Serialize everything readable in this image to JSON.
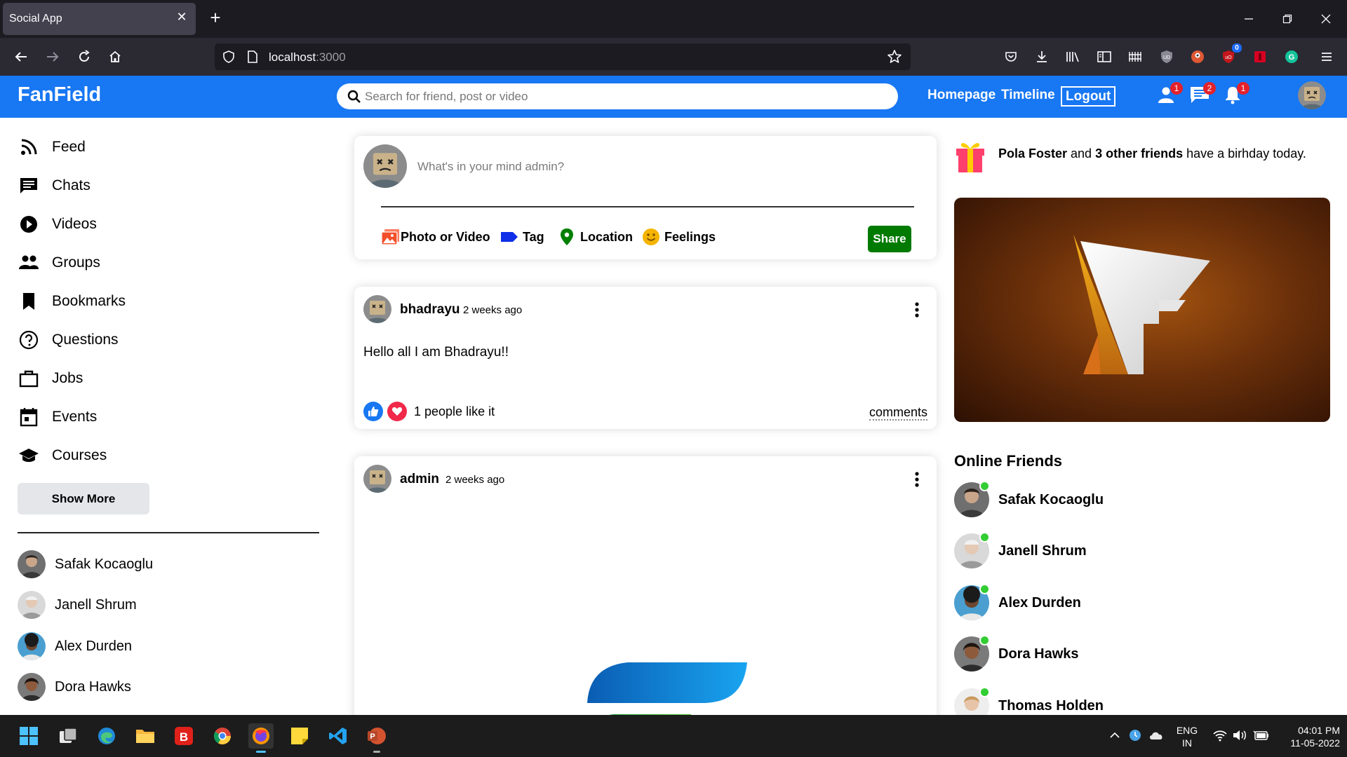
{
  "browser": {
    "tab_title": "Social App",
    "url_host": "localhost",
    "url_port": ":3000",
    "toolbar_badge": "0"
  },
  "app": {
    "brand": "FanField",
    "brand_color": "#1877f2",
    "search_placeholder": "Search for friend, post or video",
    "links": {
      "homepage": "Homepage",
      "timeline": "Timeline",
      "logout": "Logout"
    },
    "badges": {
      "friends": "1",
      "messages": "2",
      "notifications": "1"
    }
  },
  "sidebar": {
    "items": [
      {
        "label": "Feed",
        "icon": "rss-icon"
      },
      {
        "label": "Chats",
        "icon": "chat-icon"
      },
      {
        "label": "Videos",
        "icon": "play-circle-icon"
      },
      {
        "label": "Groups",
        "icon": "group-icon"
      },
      {
        "label": "Bookmarks",
        "icon": "bookmark-icon"
      },
      {
        "label": "Questions",
        "icon": "help-circle-icon"
      },
      {
        "label": "Jobs",
        "icon": "briefcase-icon"
      },
      {
        "label": "Events",
        "icon": "calendar-icon"
      },
      {
        "label": "Courses",
        "icon": "school-icon"
      }
    ],
    "show_more": "Show More",
    "friends": [
      {
        "name": "Safak Kocaoglu"
      },
      {
        "name": "Janell Shrum"
      },
      {
        "name": "Alex Durden"
      },
      {
        "name": "Dora Hawks"
      }
    ]
  },
  "share": {
    "placeholder": "What's in your mind admin?",
    "options": {
      "photo": "Photo or Video",
      "tag": "Tag",
      "location": "Location",
      "feelings": "Feelings"
    },
    "button": "Share"
  },
  "posts": [
    {
      "user": "bhadrayu",
      "time": "2 weeks ago",
      "text": "Hello all I am Bhadrayu!!",
      "likes": "1 people like it",
      "comments": "comments"
    },
    {
      "user": "admin",
      "time": "2 weeks ago"
    }
  ],
  "rightbar": {
    "birthday": {
      "name": "Pola Foster",
      "and": " and ",
      "others": "3 other friends",
      "tail": " have a birhday today."
    },
    "online_title": "Online Friends",
    "online": [
      {
        "name": "Safak Kocaoglu"
      },
      {
        "name": "Janell Shrum"
      },
      {
        "name": "Alex Durden"
      },
      {
        "name": "Dora Hawks"
      },
      {
        "name": "Thomas Holden"
      }
    ],
    "online_color": "#32cd32"
  },
  "taskbar": {
    "lang_1": "ENG",
    "lang_2": "IN",
    "time": "04:01 PM",
    "date": "11-05-2022"
  }
}
